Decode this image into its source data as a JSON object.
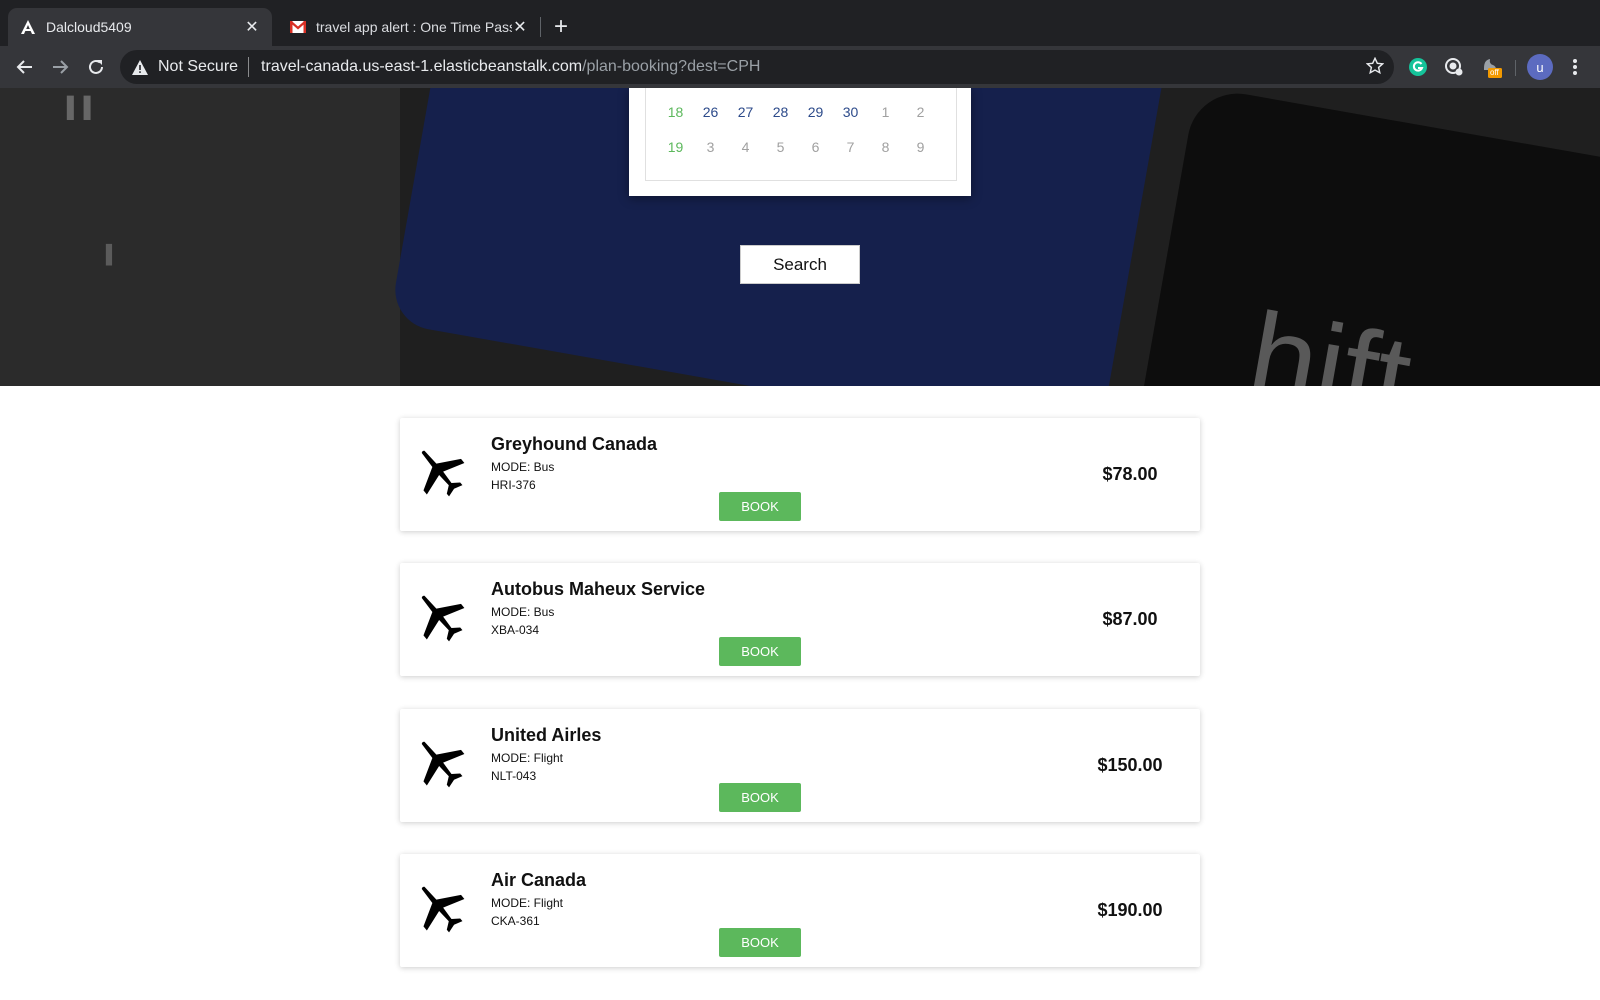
{
  "browser": {
    "tabs": [
      {
        "title": "Dalcloud5409",
        "active": true
      },
      {
        "title": "travel app alert : One Time Passw",
        "active": false
      }
    ],
    "url_security": "Not Secure",
    "url_host": "travel-canada.us-east-1.elasticbeanstalk.com",
    "url_path": "/plan-booking?dest=CPH",
    "profile_initial": "u",
    "ext_badge": "off"
  },
  "calendar": {
    "rows": [
      {
        "week": "18",
        "days": [
          "26",
          "27",
          "28",
          "29",
          "30",
          "1",
          "2"
        ]
      },
      {
        "week": "19",
        "days": [
          "3",
          "4",
          "5",
          "6",
          "7",
          "8",
          "9"
        ]
      }
    ]
  },
  "search_label": "Search",
  "results": [
    {
      "name": "Greyhound Canada",
      "mode": "MODE: Bus",
      "code": "HRI-376",
      "price": "$78.00",
      "book": "BOOK"
    },
    {
      "name": "Autobus Maheux Service",
      "mode": "MODE: Bus",
      "code": "XBA-034",
      "price": "$87.00",
      "book": "BOOK"
    },
    {
      "name": "United Airles",
      "mode": "MODE: Flight",
      "code": "NLT-043",
      "price": "$150.00",
      "book": "BOOK"
    },
    {
      "name": "Air Canada",
      "mode": "MODE: Flight",
      "code": "CKA-361",
      "price": "$190.00",
      "book": "BOOK"
    }
  ],
  "colors": {
    "book": "#5cb85c",
    "week": "#5cb85c",
    "current_month": "#2c4a8a"
  }
}
